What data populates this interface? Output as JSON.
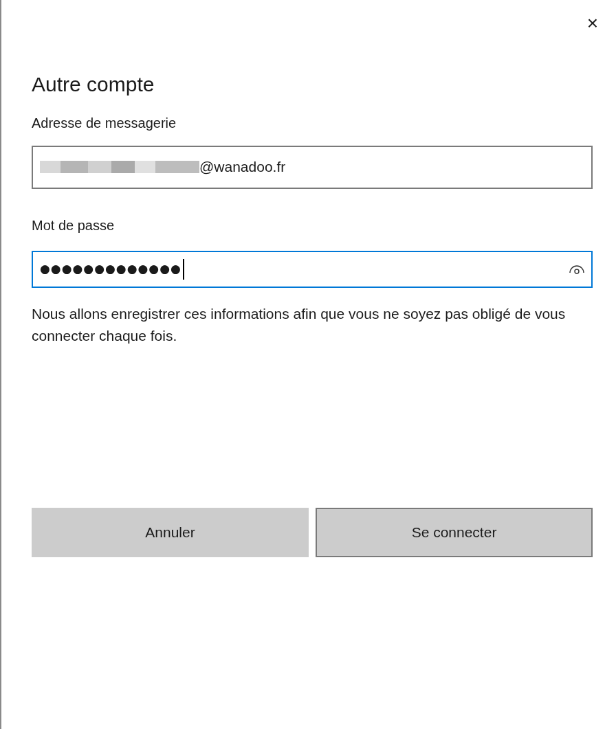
{
  "dialog": {
    "close": "×",
    "title": "Autre compte"
  },
  "email": {
    "label": "Adresse de messagerie",
    "redacted": true,
    "value": "@wanadoo.fr"
  },
  "password": {
    "label": "Mot de passe",
    "value": "●●●●●●●●●●●●●",
    "focused": true
  },
  "notice": "Nous allons enregistrer ces informations afin que vous ne soyez pas obligé de vous connecter chaque fois.",
  "buttons": [
    {
      "label": "Annuler",
      "hovered": false
    },
    {
      "label": "Se connecter",
      "hovered": true
    }
  ]
}
